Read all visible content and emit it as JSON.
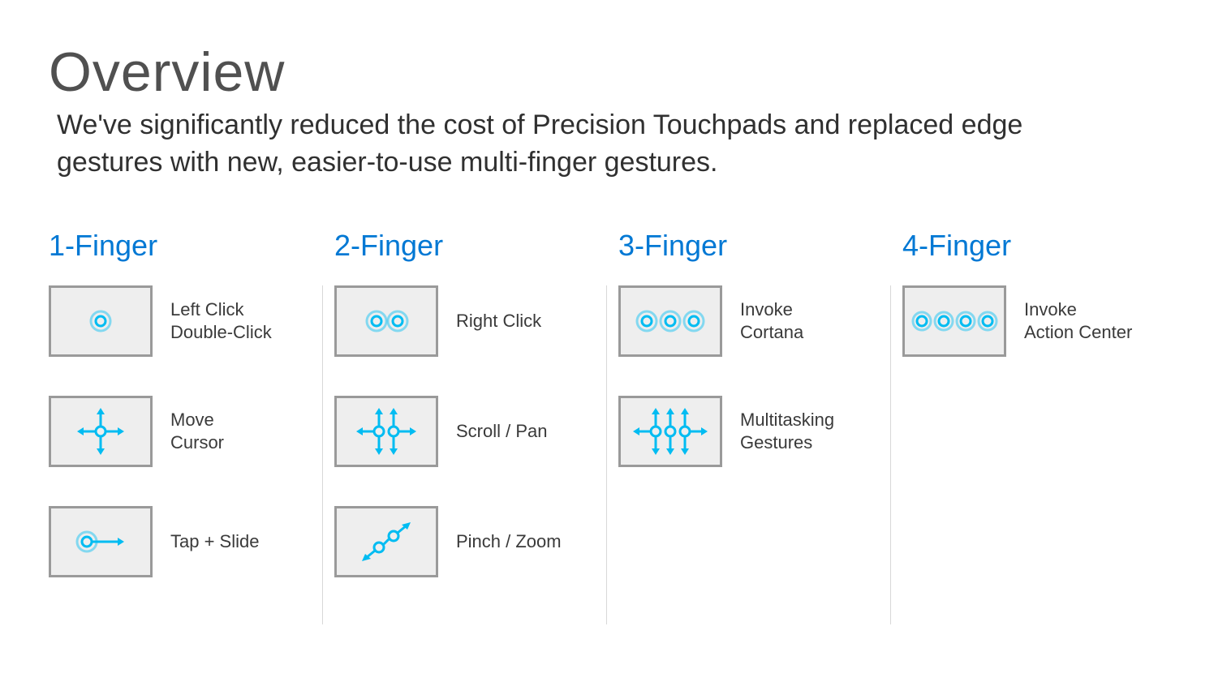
{
  "title": "Overview",
  "subtitle": "We've significantly reduced the cost of Precision Touchpads and replaced edge gestures with new, easier-to-use multi-finger gestures.",
  "columns": [
    {
      "heading": "1-Finger",
      "items": [
        {
          "label": "Left Click\nDouble-Click"
        },
        {
          "label": "Move\nCursor"
        },
        {
          "label": "Tap + Slide"
        }
      ]
    },
    {
      "heading": "2-Finger",
      "items": [
        {
          "label": "Right Click"
        },
        {
          "label": "Scroll / Pan"
        },
        {
          "label": "Pinch / Zoom"
        }
      ]
    },
    {
      "heading": "3-Finger",
      "items": [
        {
          "label": "Invoke\nCortana"
        },
        {
          "label": "Multitasking\nGestures"
        }
      ]
    },
    {
      "heading": "4-Finger",
      "items": [
        {
          "label": "Invoke\nAction Center"
        }
      ]
    }
  ]
}
